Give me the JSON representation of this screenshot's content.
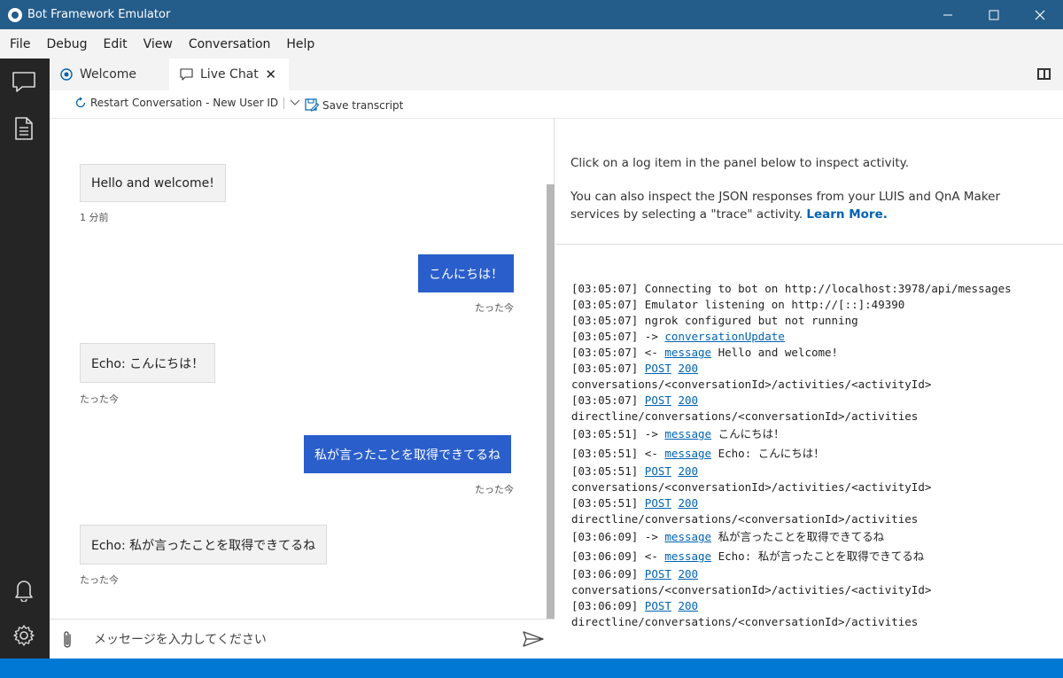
{
  "window": {
    "title": "Bot Framework Emulator"
  },
  "menu": [
    "File",
    "Debug",
    "Edit",
    "View",
    "Conversation",
    "Help"
  ],
  "tabs": {
    "welcome": "Welcome",
    "livechat": "Live Chat"
  },
  "toolbar": {
    "restart_label": "Restart Conversation - New User ID",
    "save_label": "Save transcript"
  },
  "chat": {
    "messages": [
      {
        "from": "bot",
        "text": "Hello and welcome!",
        "time": "1 分前"
      },
      {
        "from": "user",
        "text": "こんにちは！",
        "time": "たった今"
      },
      {
        "from": "bot",
        "text": "Echo: こんにちは！",
        "time": "たった今"
      },
      {
        "from": "user",
        "text": "私が言ったことを取得できてるね",
        "time": "たった今"
      },
      {
        "from": "bot",
        "text": "Echo: 私が言ったことを取得できてるね",
        "time": "たった今"
      }
    ],
    "input_placeholder": "メッセージを入力してください"
  },
  "inspector": {
    "line1": "Click on a log item in the panel below to inspect activity.",
    "line2": "You can also inspect the JSON responses from your LUIS and QnA Maker services by selecting a \"trace\" activity.",
    "learn_more": "Learn More."
  },
  "log": {
    "entries": [
      {
        "time": "[03:05:07]",
        "text": "Connecting to bot on http://localhost:3978/api/messages"
      },
      {
        "time": "[03:05:07]",
        "text": "Emulator listening on http://[::]:49390"
      },
      {
        "time": "[03:05:07]",
        "text": "ngrok configured but not running"
      },
      {
        "time": "[03:05:07]",
        "arrow": "->",
        "link": "conversationUpdate"
      },
      {
        "time": "[03:05:07]",
        "arrow": "<-",
        "link": "message",
        "text": "Hello and welcome!"
      },
      {
        "time": "[03:05:07]",
        "link": "POST",
        "code": "200",
        "sub": "conversations/<conversationId>/activities/<activityId>"
      },
      {
        "time": "[03:05:07]",
        "link": "POST",
        "code": "200",
        "sub": "directline/conversations/<conversationId>/activities"
      },
      {
        "time": "[03:05:51]",
        "arrow": "->",
        "link": "message",
        "text": "こんにちは！"
      },
      {
        "time": "[03:05:51]",
        "arrow": "<-",
        "link": "message",
        "text": "Echo: こんにちは！"
      },
      {
        "time": "[03:05:51]",
        "link": "POST",
        "code": "200",
        "sub": "conversations/<conversationId>/activities/<activityId>"
      },
      {
        "time": "[03:05:51]",
        "link": "POST",
        "code": "200",
        "sub": "directline/conversations/<conversationId>/activities"
      },
      {
        "time": "[03:06:09]",
        "arrow": "->",
        "link": "message",
        "text": "私が言ったことを取得できてるね"
      },
      {
        "time": "[03:06:09]",
        "arrow": "<-",
        "link": "message",
        "text": "Echo: 私が言ったことを取得できてるね"
      },
      {
        "time": "[03:06:09]",
        "link": "POST",
        "code": "200",
        "sub": "conversations/<conversationId>/activities/<activityId>"
      },
      {
        "time": "[03:06:09]",
        "link": "POST",
        "code": "200",
        "sub": "directline/conversations/<conversationId>/activities"
      }
    ]
  },
  "icons": {
    "chat": "chat-icon",
    "document": "document-icon",
    "bell": "bell-icon",
    "settings": "gear-icon"
  },
  "colors": {
    "titlebar": "#245c8a",
    "user_bubble": "#2a5ecb",
    "status_bar": "#0078d4",
    "link": "#0063b1"
  }
}
